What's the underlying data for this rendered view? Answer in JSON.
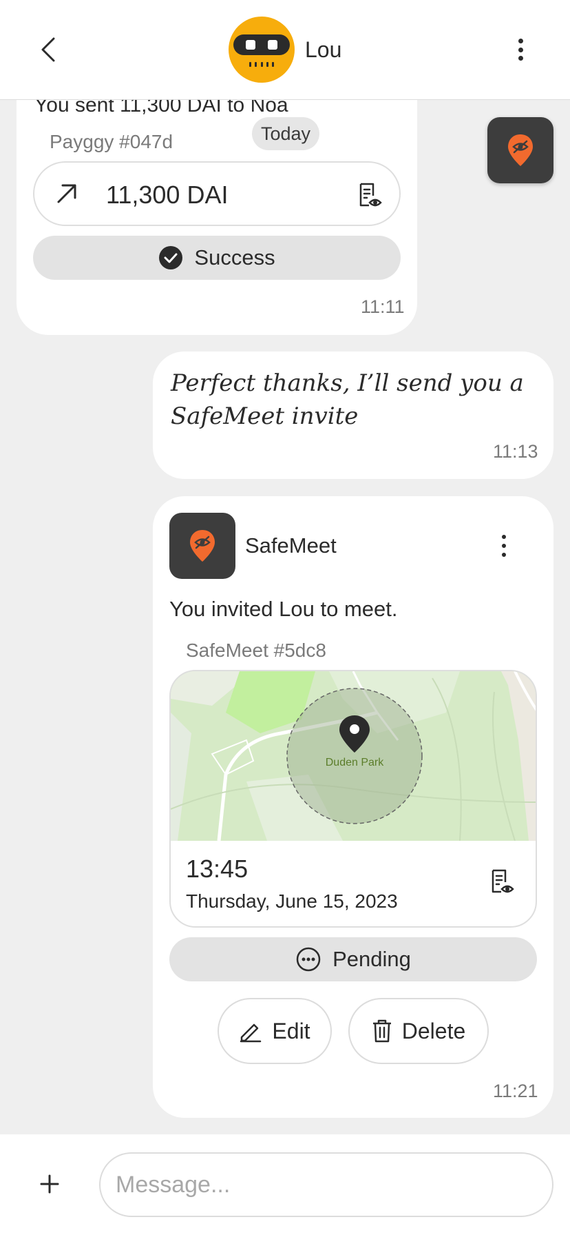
{
  "header": {
    "contact_name": "Lou",
    "back_icon": "chevron-left-icon",
    "menu_icon": "more-vertical-icon",
    "avatar_color": "#f7ad0c"
  },
  "date_chip": "Today",
  "payment_bubble": {
    "summary_partial": "You sent 11,300 DAI to Noa",
    "reference": "Payggy #047d",
    "amount": "11,300 DAI",
    "status": "Success",
    "time": "11:11"
  },
  "text_message": {
    "text": "Perfect thanks, I’ll send you a SafeMeet invite",
    "time": "11:13"
  },
  "safemeet_bubble": {
    "app_name": "SafeMeet",
    "invite_text": "You invited Lou to meet.",
    "reference": "SafeMeet #5dc8",
    "map_place": "Duden Park",
    "meet_time": "13:45",
    "meet_date": "Thursday, June 15, 2023",
    "status": "Pending",
    "edit_label": "Edit",
    "delete_label": "Delete",
    "time": "11:21"
  },
  "composer": {
    "placeholder": "Message..."
  },
  "colors": {
    "accent_orange": "#f26a2e",
    "icon_tile": "#3d3d3d",
    "background": "#efefef"
  }
}
